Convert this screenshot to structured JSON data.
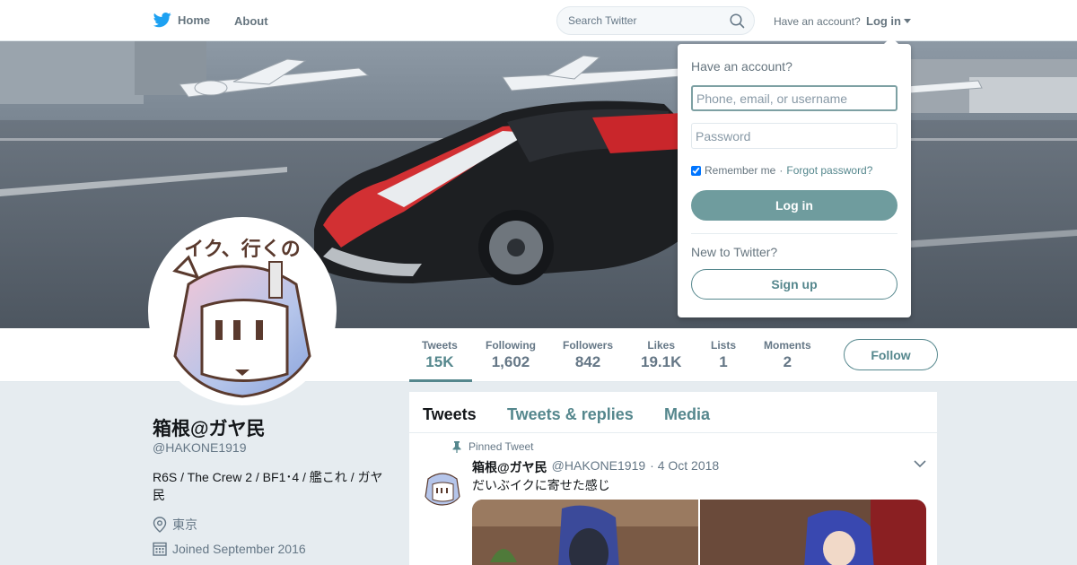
{
  "topbar": {
    "home_label": "Home",
    "about_label": "About",
    "search_placeholder": "Search Twitter",
    "have_account": "Have an account?",
    "login_label": "Log in",
    "brand_color": "#1da1f2"
  },
  "profile": {
    "name": "箱根@ガヤ民",
    "handle": "@HAKONE1919",
    "bio": "R6S / The Crew 2 / BF1･4 / 艦これ / ガヤ民",
    "location": "東京",
    "joined": "Joined September 2016",
    "avatar_caption": "イク、行くの",
    "theme_color": "#55878d"
  },
  "stats": [
    {
      "label": "Tweets",
      "value": "15K"
    },
    {
      "label": "Following",
      "value": "1,602"
    },
    {
      "label": "Followers",
      "value": "842"
    },
    {
      "label": "Likes",
      "value": "19.1K"
    },
    {
      "label": "Lists",
      "value": "1"
    },
    {
      "label": "Moments",
      "value": "2"
    }
  ],
  "follow_label": "Follow",
  "timeline": {
    "tabs": [
      "Tweets",
      "Tweets & replies",
      "Media"
    ],
    "pinned_label": "Pinned Tweet",
    "tweet": {
      "name": "箱根@ガヤ民",
      "handle": "@HAKONE1919",
      "date": "· 4 Oct 2018",
      "text": "だいぶイクに寄せた感じ"
    }
  },
  "login_dropdown": {
    "title": "Have an account?",
    "username_placeholder": "Phone, email, or username",
    "password_placeholder": "Password",
    "remember_label": "Remember me",
    "forgot_label": "Forgot password?",
    "login_button": "Log in",
    "new_label": "New to Twitter?",
    "signup_button": "Sign up"
  }
}
